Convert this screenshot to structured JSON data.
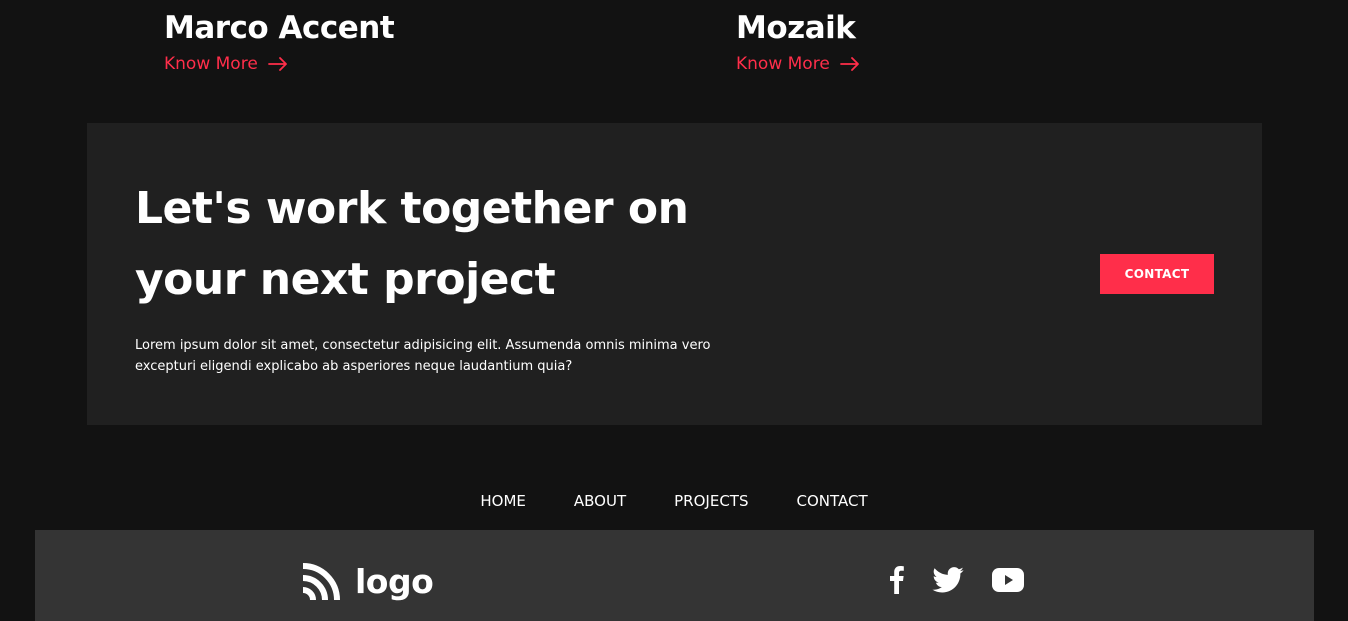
{
  "projects": [
    {
      "title": "Marco Accent",
      "link_label": "Know More"
    },
    {
      "title": "Mozaik",
      "link_label": "Know More"
    }
  ],
  "cta": {
    "heading": "Let's work together on your next project",
    "text": "Lorem ipsum dolor sit amet, consectetur adipisicing elit. Assumenda omnis minima vero excepturi eligendi explicabo ab asperiores neque laudantium quia?",
    "button_label": "CONTACT"
  },
  "nav": {
    "items": [
      {
        "label": "HOME"
      },
      {
        "label": "ABOUT"
      },
      {
        "label": "PROJECTS"
      },
      {
        "label": "CONTACT"
      }
    ]
  },
  "footer": {
    "logo_text": "logo",
    "socials": [
      "facebook-icon",
      "twitter-icon",
      "youtube-icon"
    ]
  },
  "colors": {
    "background": "#121212",
    "panel": "#202020",
    "footer": "#343434",
    "accent": "#ff2e4a",
    "text": "#ffffff"
  }
}
